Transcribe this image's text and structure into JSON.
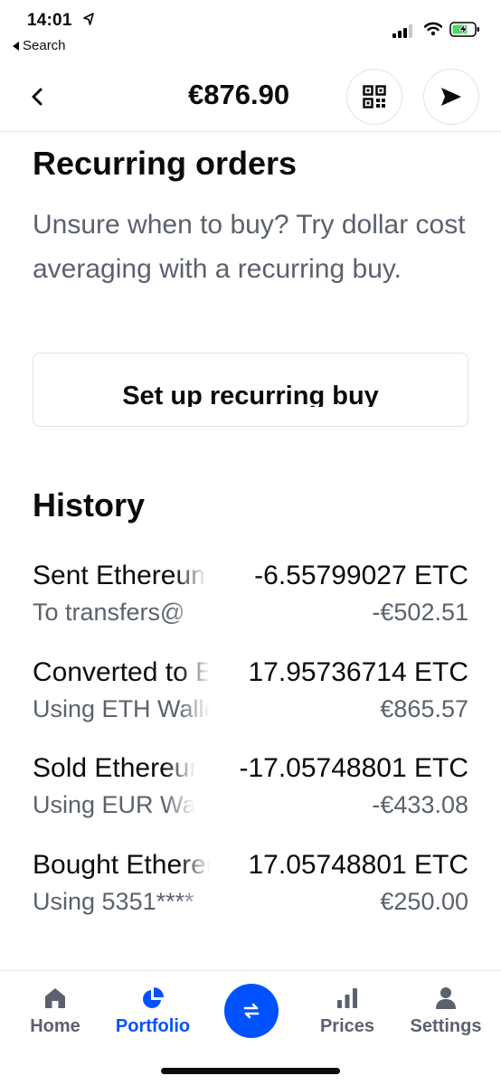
{
  "status_bar": {
    "time": "14:01",
    "back_label": "Search"
  },
  "header": {
    "balance": "€876.90",
    "back_icon": "chevron-left-icon",
    "qr_icon": "qr-code-icon",
    "send_icon": "send-icon"
  },
  "recurring": {
    "title": "Recurring orders",
    "description": "Unsure when to buy? Try dollar cost averaging with a recurring buy.",
    "button_label": "Set up recurring buy"
  },
  "history": {
    "title": "History",
    "items": [
      {
        "title": "Sent Ethereum Classic",
        "subtitle": "To transfers@",
        "amount": "-6.55799027 ETC",
        "value": "-€502.51"
      },
      {
        "title": "Converted to Ethereum Classic",
        "subtitle": "Using ETH Wallet",
        "amount": "17.95736714 ETC",
        "value": "€865.57"
      },
      {
        "title": "Sold Ethereum Classic",
        "subtitle": "Using EUR Wallet",
        "amount": "-17.05748801 ETC",
        "value": "-€433.08"
      },
      {
        "title": "Bought Ethereum Classic",
        "subtitle": "Using 5351****",
        "amount": "17.05748801 ETC",
        "value": "€250.00"
      }
    ]
  },
  "tabs": [
    {
      "label": "Home",
      "icon": "home-icon",
      "active": false
    },
    {
      "label": "Portfolio",
      "icon": "pie-chart-icon",
      "active": true
    },
    {
      "label": "Trade",
      "icon": "swap-icon",
      "active": false
    },
    {
      "label": "Prices",
      "icon": "bar-chart-icon",
      "active": false
    },
    {
      "label": "Settings",
      "icon": "user-icon",
      "active": false
    }
  ],
  "colors": {
    "accent": "#0052ff",
    "text": "#0a0b0d",
    "secondary": "#5b616e",
    "border": "#dfe2e6"
  }
}
